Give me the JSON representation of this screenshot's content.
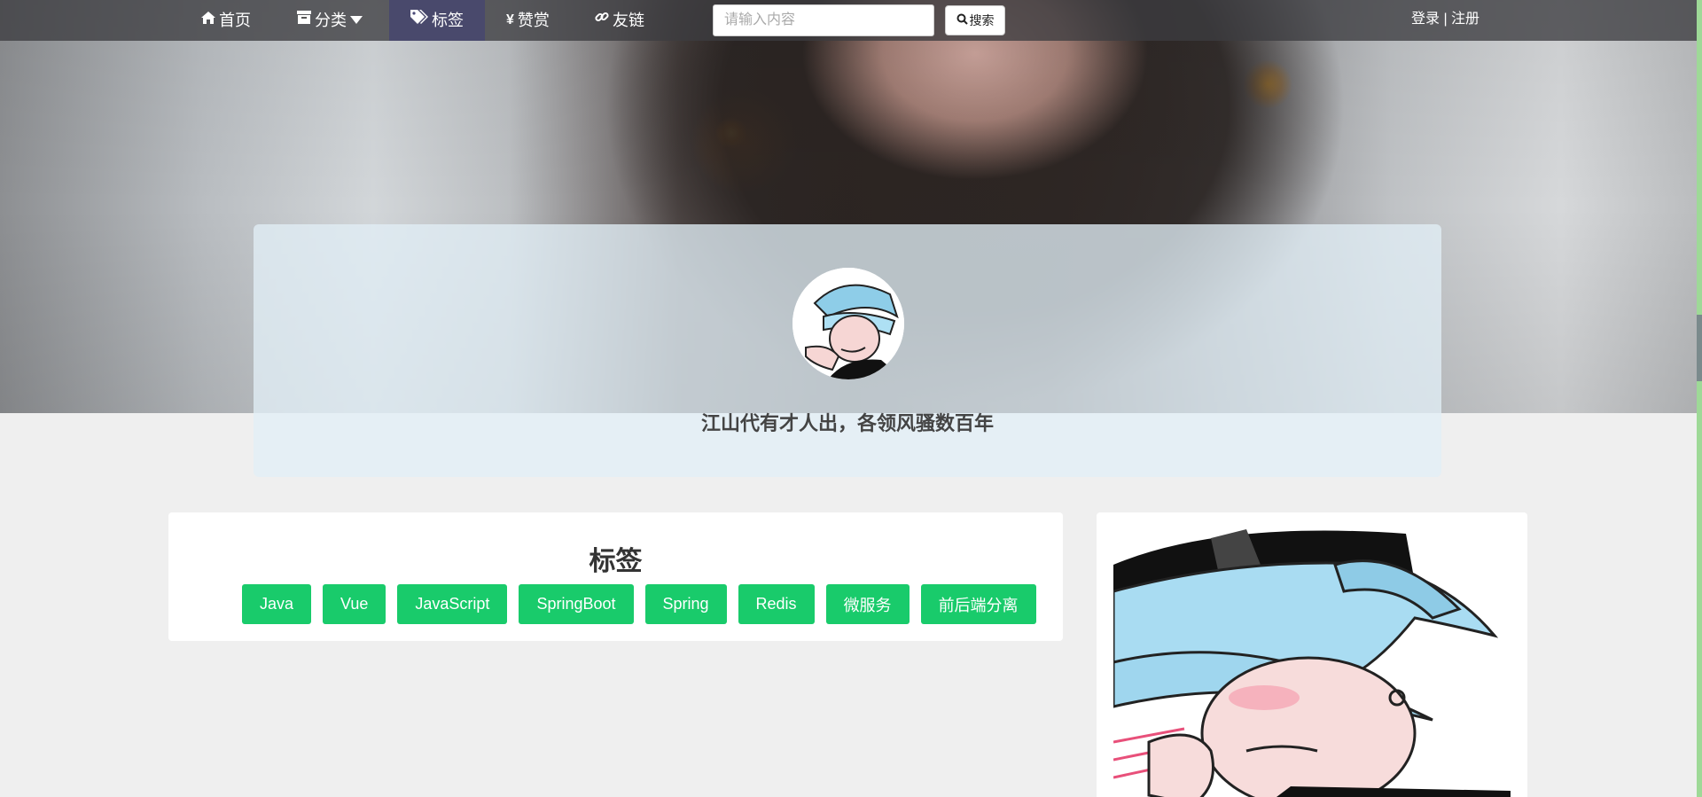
{
  "nav": {
    "home": "首页",
    "category": "分类",
    "tags": "标签",
    "reward": "赞赏",
    "links": "友链",
    "search_placeholder": "请输入内容",
    "search_button": "搜索",
    "auth": "登录 | 注册",
    "icons": {
      "home": "home-icon",
      "category": "archive-icon",
      "dropdown": "caret-down-icon",
      "tags": "tags-icon",
      "reward": "yen-icon",
      "links": "link-icon",
      "search": "search-icon"
    }
  },
  "intro": {
    "motto": "江山代有才人出，各领风骚数百年"
  },
  "tags_panel": {
    "title": "标签",
    "items": [
      "Java",
      "Vue",
      "JavaScript",
      "SpringBoot",
      "Spring",
      "Redis",
      "微服务",
      "前后端分离"
    ],
    "color": "#19cb6b"
  },
  "colors": {
    "nav_bg": "#3c3c40",
    "page_bg": "#efefef",
    "accent": "#19cb6b"
  }
}
